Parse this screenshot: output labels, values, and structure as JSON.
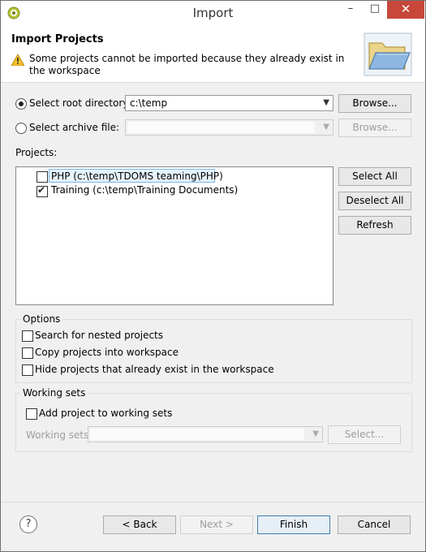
{
  "window": {
    "title": "Import"
  },
  "header": {
    "title": "Import Projects",
    "message": "Some projects cannot be imported because they already exist in the workspace"
  },
  "source": {
    "root_label": "Select root directory:",
    "root_selected": true,
    "root_value": "c:\\temp",
    "root_browse": "Browse...",
    "archive_label": "Select archive file:",
    "archive_selected": false,
    "archive_value": "",
    "archive_browse": "Browse..."
  },
  "projects": {
    "label": "Projects:",
    "items": [
      {
        "label": "PHP (c:\\temp\\TDOMS teaming\\PHP)",
        "checked": false,
        "selected": true
      },
      {
        "label": "Training (c:\\temp\\Training Documents)",
        "checked": true,
        "selected": false
      }
    ],
    "select_all": "Select All",
    "deselect_all": "Deselect All",
    "refresh": "Refresh"
  },
  "options": {
    "title": "Options",
    "items": [
      {
        "label": "Search for nested projects",
        "checked": false
      },
      {
        "label": "Copy projects into workspace",
        "checked": false
      },
      {
        "label": "Hide projects that already exist in the workspace",
        "checked": false
      }
    ]
  },
  "working_sets": {
    "title": "Working sets",
    "add_label": "Add project to working sets",
    "add_checked": false,
    "sets_label": "Working sets:",
    "sets_value": "",
    "select_button": "Select..."
  },
  "footer": {
    "help": "?",
    "back": "< Back",
    "next": "Next >",
    "finish": "Finish",
    "cancel": "Cancel"
  },
  "icons": {
    "app": "eclipse-icon",
    "warning": "warning-icon",
    "header": "folder-wizard-icon"
  }
}
